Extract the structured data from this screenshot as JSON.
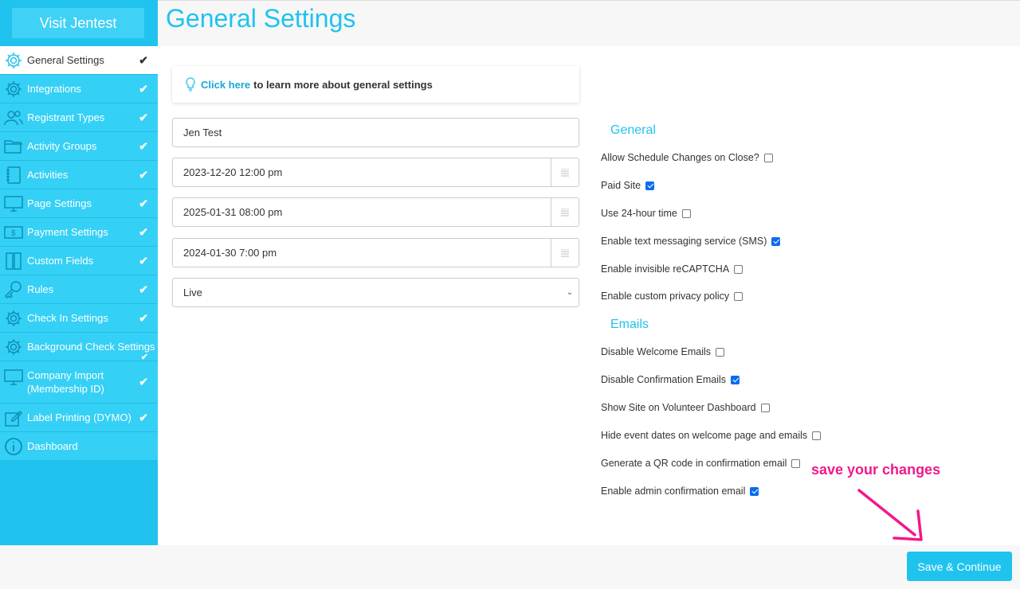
{
  "sidebar": {
    "visit_label": "Visit Jentest",
    "items": [
      {
        "label": "General Settings",
        "icon": "gear-icon",
        "check": "✔"
      },
      {
        "label": "Integrations",
        "icon": "gear-icon",
        "check": "✔"
      },
      {
        "label": "Registrant Types",
        "icon": "users-icon",
        "check": "✔"
      },
      {
        "label": "Activity Groups",
        "icon": "folder-icon",
        "check": "✔"
      },
      {
        "label": "Activities",
        "icon": "notebook-icon",
        "check": "✔"
      },
      {
        "label": "Page Settings",
        "icon": "monitor-icon",
        "check": "✔"
      },
      {
        "label": "Payment Settings",
        "icon": "dollar-icon",
        "check": "✔"
      },
      {
        "label": "Custom Fields",
        "icon": "book-icon",
        "check": "✔"
      },
      {
        "label": "Rules",
        "icon": "key-icon",
        "check": "✔"
      },
      {
        "label": "Check In Settings",
        "icon": "gear-icon",
        "check": "✔"
      },
      {
        "label": "Background Check Settings",
        "icon": "gear-icon",
        "check": "✔"
      },
      {
        "label_line1": "Company Import",
        "label_line2": "(Membership ID)",
        "icon": "monitor-icon",
        "check": "✔"
      },
      {
        "label": "Label Printing (DYMO)",
        "icon": "edit-icon",
        "check": "✔"
      },
      {
        "label": "Dashboard",
        "icon": "info-icon"
      }
    ]
  },
  "header": {
    "title": "General Settings"
  },
  "info": {
    "link": "Click here",
    "text": "to learn more about general settings"
  },
  "form": {
    "site_name": "Jen Test",
    "date1": "2023-12-20 12:00 pm",
    "date2": "2025-01-31 08:00 pm",
    "date3": "2024-01-30 7:00 pm",
    "status": "Live"
  },
  "general": {
    "title": "General",
    "options": [
      {
        "label": "Allow Schedule Changes on Close?",
        "checked": false
      },
      {
        "label": "Paid Site",
        "checked": true
      },
      {
        "label": "Use 24-hour time",
        "checked": false
      },
      {
        "label": "Enable text messaging service (SMS)",
        "checked": true
      },
      {
        "label": "Enable invisible reCAPTCHA",
        "checked": false
      },
      {
        "label": "Enable custom privacy policy",
        "checked": false
      }
    ]
  },
  "emails": {
    "title": "Emails",
    "options": [
      {
        "label": "Disable Welcome Emails",
        "checked": false
      },
      {
        "label": "Disable Confirmation Emails",
        "checked": true
      },
      {
        "label": "Show Site on Volunteer Dashboard",
        "checked": false
      },
      {
        "label": "Hide event dates on welcome page and emails",
        "checked": false
      },
      {
        "label": "Generate a QR code in confirmation email",
        "checked": false
      },
      {
        "label": "Enable admin confirmation email",
        "checked": true
      }
    ]
  },
  "annotation": {
    "text": "save your changes",
    "color": "#f0198c"
  },
  "footer": {
    "save_label": "Save & Continue"
  },
  "colors": {
    "accent": "#1fc3ee",
    "checkbox": "#0a6cf0"
  }
}
